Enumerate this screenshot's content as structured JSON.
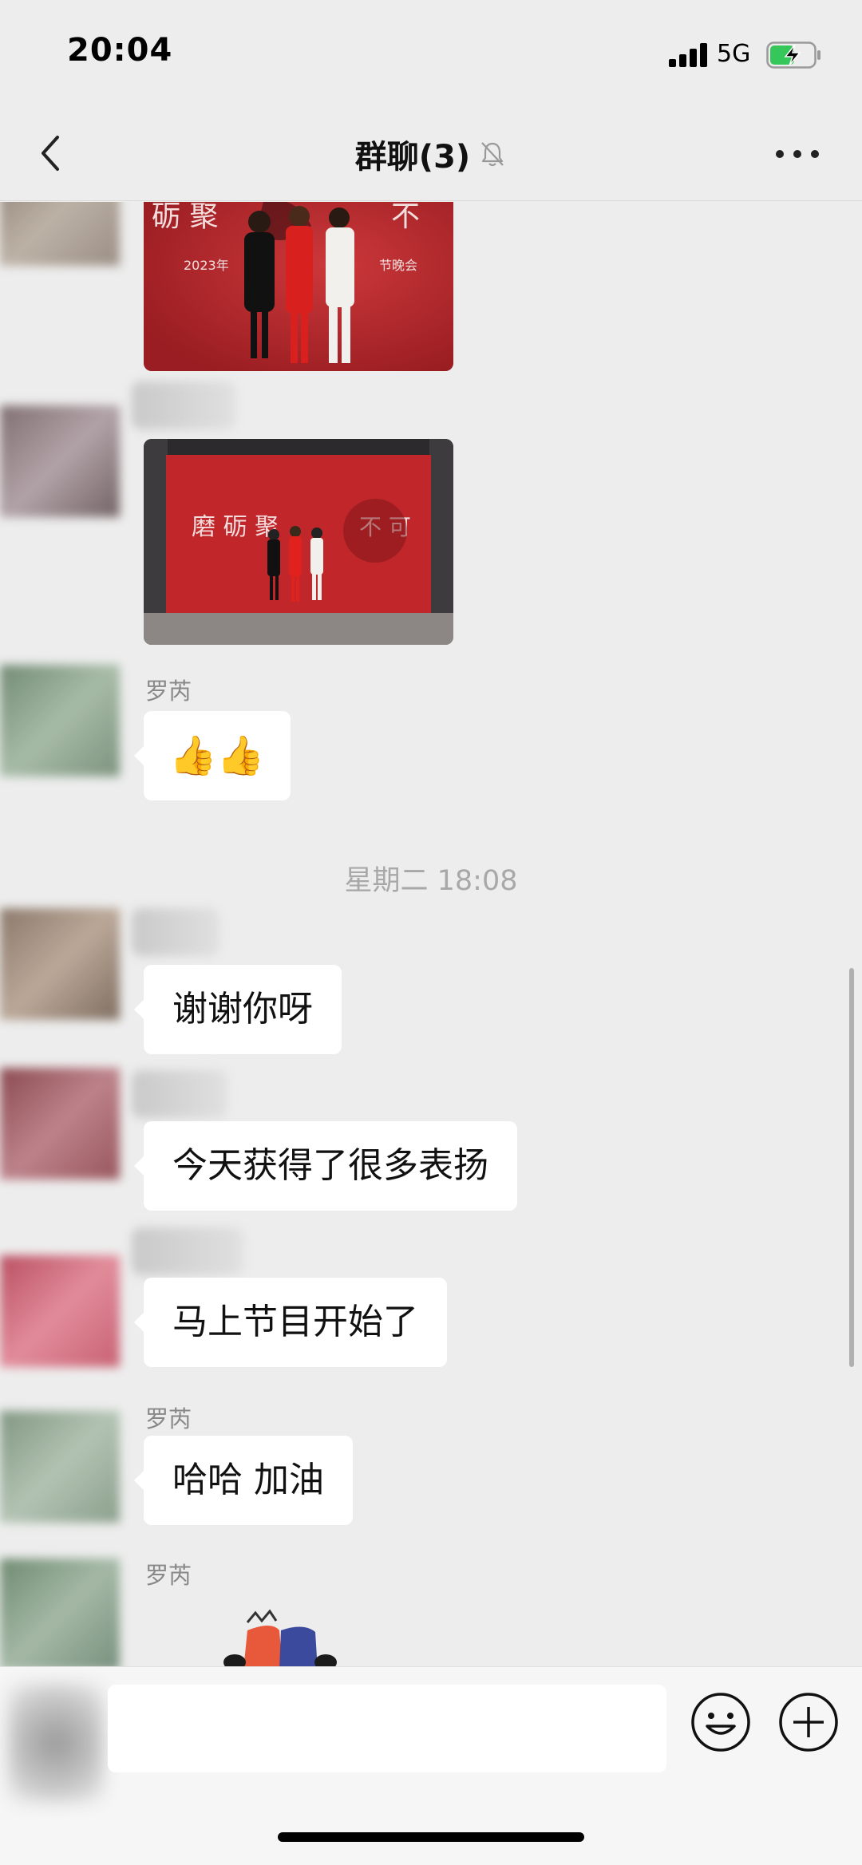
{
  "status": {
    "time": "20:04",
    "network": "5G"
  },
  "header": {
    "title": "群聊(3)",
    "back_icon": "chevron-left-icon",
    "mute_icon": "bell-off-icon",
    "more_icon": "more-dots-icon"
  },
  "messages": {
    "sender_1": "罗芮",
    "sticker_text": "👍👍",
    "timestamp": "星期二 18:08",
    "msg_1": "谢谢你呀",
    "msg_2": "今天获得了很多表扬",
    "msg_3": "马上节目开始了",
    "sender_2": "罗芮",
    "msg_4": "哈哈 加油",
    "sender_3": "罗芮"
  },
  "input": {
    "placeholder": "",
    "emoji_icon": "emoji-icon",
    "plus_icon": "plus-circle-icon"
  },
  "colors": {
    "background": "#ededed",
    "bubble": "#ffffff",
    "photo_red": "#c0262a"
  }
}
